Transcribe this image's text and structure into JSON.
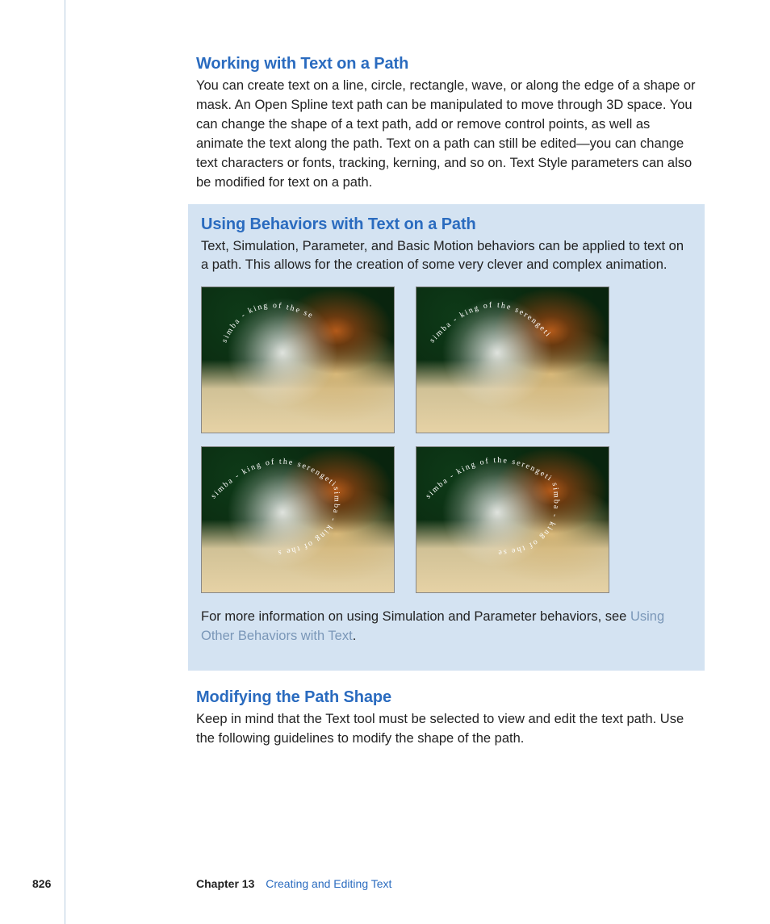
{
  "section1": {
    "heading": "Working with Text on a Path",
    "body": "You can create text on a line, circle, rectangle, wave, or along the edge of a shape or mask. An Open Spline text path can be manipulated to move through 3D space. You can change the shape of a text path, add or remove control points, as well as animate the text along the path. Text on a path can still be edited—you can change text characters or fonts, tracking, kerning, and so on. Text Style parameters can also be modified for text on a path."
  },
  "callout": {
    "heading": "Using Behaviors with Text on a Path",
    "body": "Text, Simulation, Parameter, and Basic Motion behaviors can be applied to text on a path. This allows for the creation of some very clever and complex animation.",
    "image_caption": "simba - king of the serengeti",
    "footer_pre": "For more information on using Simulation and Parameter behaviors, see ",
    "footer_link": "Using Other Behaviors with Text",
    "footer_post": "."
  },
  "section2": {
    "heading": "Modifying the Path Shape",
    "body": "Keep in mind that the Text tool must be selected to view and edit the text path. Use the following guidelines to modify the shape of the path."
  },
  "footer": {
    "page": "826",
    "chapter_label": "Chapter 13",
    "chapter_title": "Creating and Editing Text"
  }
}
